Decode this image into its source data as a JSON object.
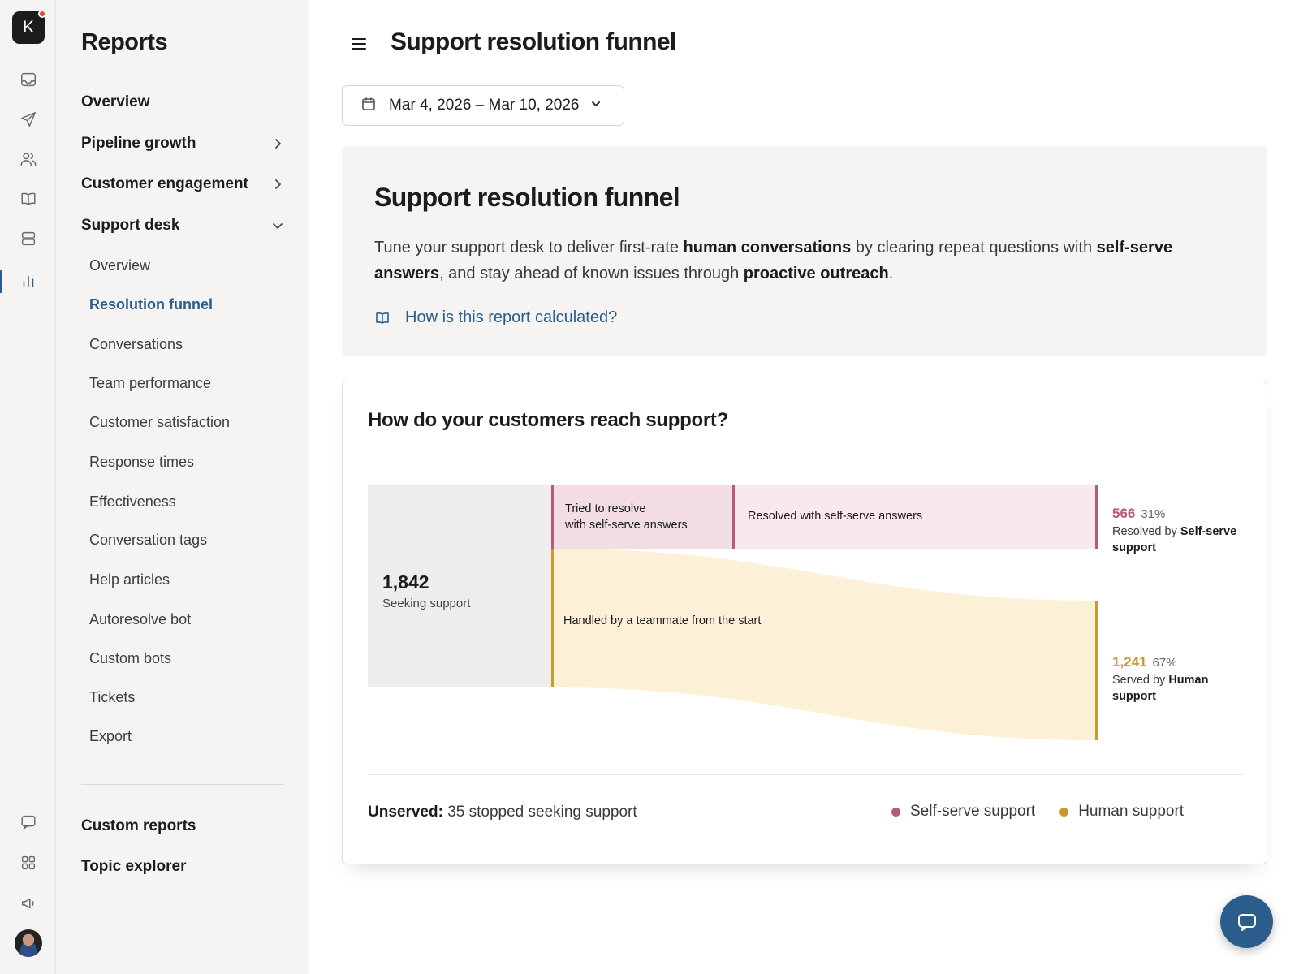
{
  "app": {
    "logo_letter": "K"
  },
  "rail": {
    "icons": [
      "inbox-icon",
      "send-icon",
      "contacts-icon",
      "knowledge-book-icon",
      "stack-icon",
      "reports-chart-icon",
      "chat-icon",
      "apps-grid-icon",
      "megaphone-icon"
    ],
    "active": "reports-chart-icon"
  },
  "nav": {
    "title": "Reports",
    "overview": "Overview",
    "pipeline": "Pipeline growth",
    "engagement": "Customer engagement",
    "support": "Support desk",
    "sub_items": [
      {
        "label": "Overview"
      },
      {
        "label": "Resolution funnel",
        "active": true
      },
      {
        "label": "Conversations"
      },
      {
        "label": "Team performance"
      },
      {
        "label": "Customer satisfaction"
      },
      {
        "label": "Response times"
      },
      {
        "label": "Effectiveness"
      },
      {
        "label": "Conversation tags"
      },
      {
        "label": "Help articles"
      },
      {
        "label": "Autoresolve bot"
      },
      {
        "label": "Custom bots"
      },
      {
        "label": "Tickets"
      },
      {
        "label": "Export"
      }
    ],
    "custom_reports": "Custom reports",
    "topic_explorer": "Topic explorer"
  },
  "header": {
    "title": "Support resolution funnel"
  },
  "date_range": {
    "label": "Mar 4, 2026 – Mar 10, 2026"
  },
  "intro": {
    "title": "Support resolution funnel",
    "desc": {
      "p1": "Tune your support desk to deliver first-rate ",
      "b1": "human conversations",
      "p2": " by clearing repeat questions with ",
      "b2": "self-serve answers",
      "p3": ", and stay ahead of known issues through ",
      "b3": "proactive outreach",
      "p4": "."
    },
    "link": "How is this report calculated?"
  },
  "funnel": {
    "title": "How do your customers reach support?",
    "seeking": {
      "value": "1,842",
      "label": "Seeking support"
    },
    "tried_label_1": "Tried to resolve",
    "tried_label_2": "with self-serve answers",
    "resolved_label": "Resolved with self-serve answers",
    "handled_label": "Handled by a teammate from the start",
    "self": {
      "value": "566",
      "pct": "31%",
      "desc_prefix": "Resolved by ",
      "desc_bold": "Self-serve support"
    },
    "human": {
      "value": "1,241",
      "pct": "67%",
      "desc_prefix": "Served by ",
      "desc_bold": "Human support"
    },
    "unserved_label": "Unserved:",
    "unserved_text": "35 stopped seeking support",
    "legend": [
      {
        "label": "Self-serve support",
        "color": "#b75a7a"
      },
      {
        "label": "Human support",
        "color": "#c89b2e"
      }
    ]
  },
  "colors": {
    "accent": "#2b5d8c",
    "self_serve": "#b75a7a",
    "self_serve_fill": "#f1dde2",
    "human": "#c89b2e",
    "human_fill": "#fcf0d7"
  }
}
